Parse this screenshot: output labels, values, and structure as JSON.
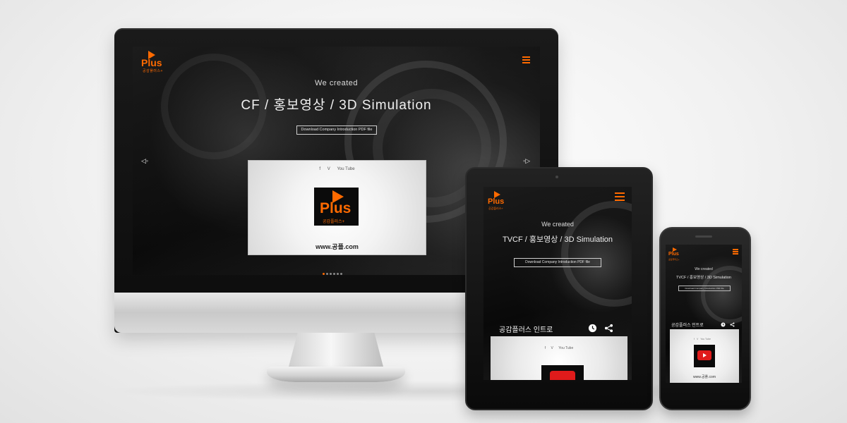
{
  "desktop": {
    "logo_word": "Plus",
    "logo_sub": "공감플러스+",
    "we_created": "We created",
    "headline": "CF / 홍보영상 / 3D Simulation",
    "download_button": "Download Company Introduction PDF file",
    "arrow_left": "◁◦",
    "arrow_right": "◦▷",
    "social": {
      "facebook": "f",
      "vimeo": "V",
      "youtube": "You Tube"
    },
    "card_brand_word": "Plus",
    "card_brand_sub": "공감플러스+",
    "card_url": "www.공플.com"
  },
  "tablet": {
    "logo_word": "Plus",
    "logo_sub": "공감플러스+",
    "we_created": "We created",
    "headline": "TVCF / 홍보영상 / 3D Simulation",
    "download_button": "Download Company Introduction PDF file",
    "intro_title": "공감플러스 인트로",
    "social": {
      "facebook": "f",
      "vimeo": "V",
      "youtube": "You Tube"
    }
  },
  "phone": {
    "logo_word": "Plus",
    "logo_sub": "공감플러스+",
    "we_created": "We created",
    "headline": "TVCF / 홍보영상 / 3D Simulation",
    "download_button": "Download Company Introduction PDF file",
    "intro_title": "공감플러스 인트로",
    "social": {
      "facebook": "f",
      "vimeo": "V",
      "youtube": "You Tube"
    },
    "card_url": "www.공플.com"
  },
  "colors": {
    "accent": "#ff6a00",
    "youtube_red": "#e01b1b",
    "screen_bg": "#0a0a0a"
  },
  "icons": [
    "play-logo-icon",
    "hamburger-menu-icon",
    "clock-icon",
    "share-icon",
    "facebook-icon",
    "vimeo-icon",
    "youtube-icon"
  ]
}
